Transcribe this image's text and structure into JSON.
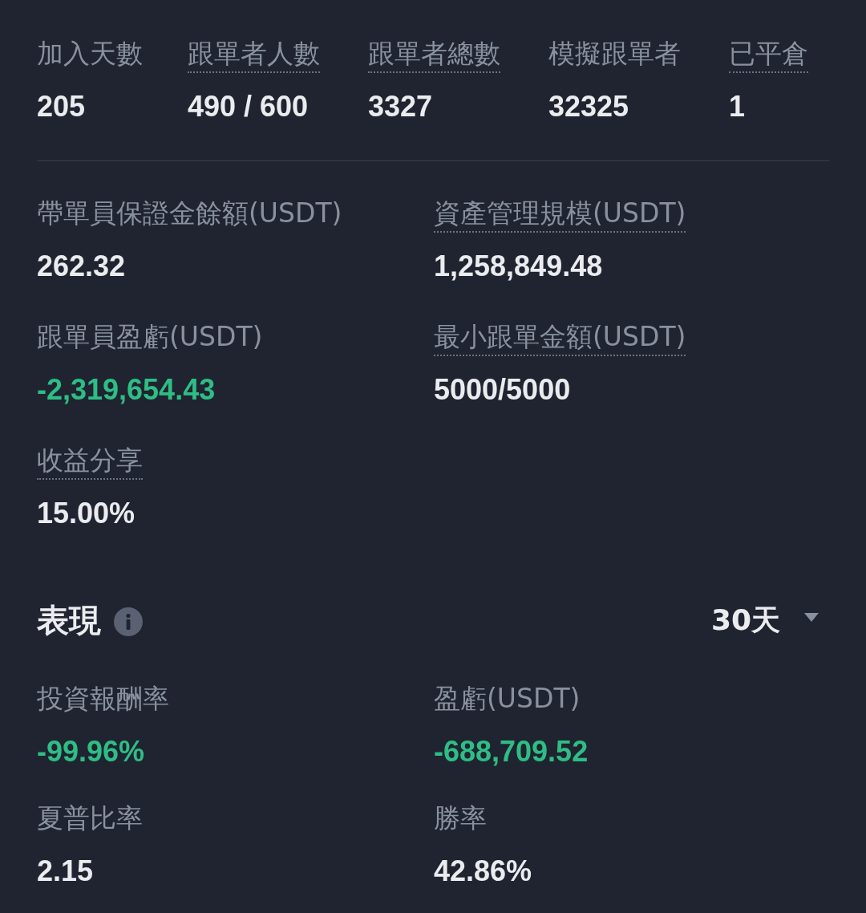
{
  "top_stats": [
    {
      "label": "加入天數",
      "value": "205",
      "underlined": false
    },
    {
      "label": "跟單者人數",
      "value": "490 / 600",
      "underlined": true
    },
    {
      "label": "跟單者總數",
      "value": "3327",
      "underlined": true
    },
    {
      "label": "模擬跟單者",
      "value": "32325",
      "underlined": false
    },
    {
      "label": "已平倉",
      "value": "1",
      "underlined": true
    }
  ],
  "details": [
    {
      "label": "帶單員保證金餘額(USDT)",
      "value": "262.32",
      "underlined": false,
      "color": "#eaecef"
    },
    {
      "label": "資產管理規模(USDT)",
      "value": "1,258,849.48",
      "underlined": true,
      "color": "#eaecef"
    },
    {
      "label": "跟單員盈虧(USDT)",
      "value": "-2,319,654.43",
      "underlined": false,
      "color": "#2ebd85"
    },
    {
      "label": "最小跟單金額(USDT)",
      "value": "5000/5000",
      "underlined": true,
      "color": "#eaecef"
    },
    {
      "label": "收益分享",
      "value": "15.00%",
      "underlined": true,
      "color": "#eaecef"
    }
  ],
  "performance": {
    "title": "表現",
    "period": "30天",
    "stats": [
      {
        "label": "投資報酬率",
        "value": "-99.96%",
        "underlined": false,
        "color": "#2ebd85"
      },
      {
        "label": "盈虧(USDT)",
        "value": "-688,709.52",
        "underlined": false,
        "color": "#2ebd85"
      },
      {
        "label": "夏普比率",
        "value": "2.15",
        "underlined": false,
        "color": "#eaecef"
      },
      {
        "label": "勝率",
        "value": "42.86%",
        "underlined": false,
        "color": "#eaecef"
      }
    ]
  }
}
